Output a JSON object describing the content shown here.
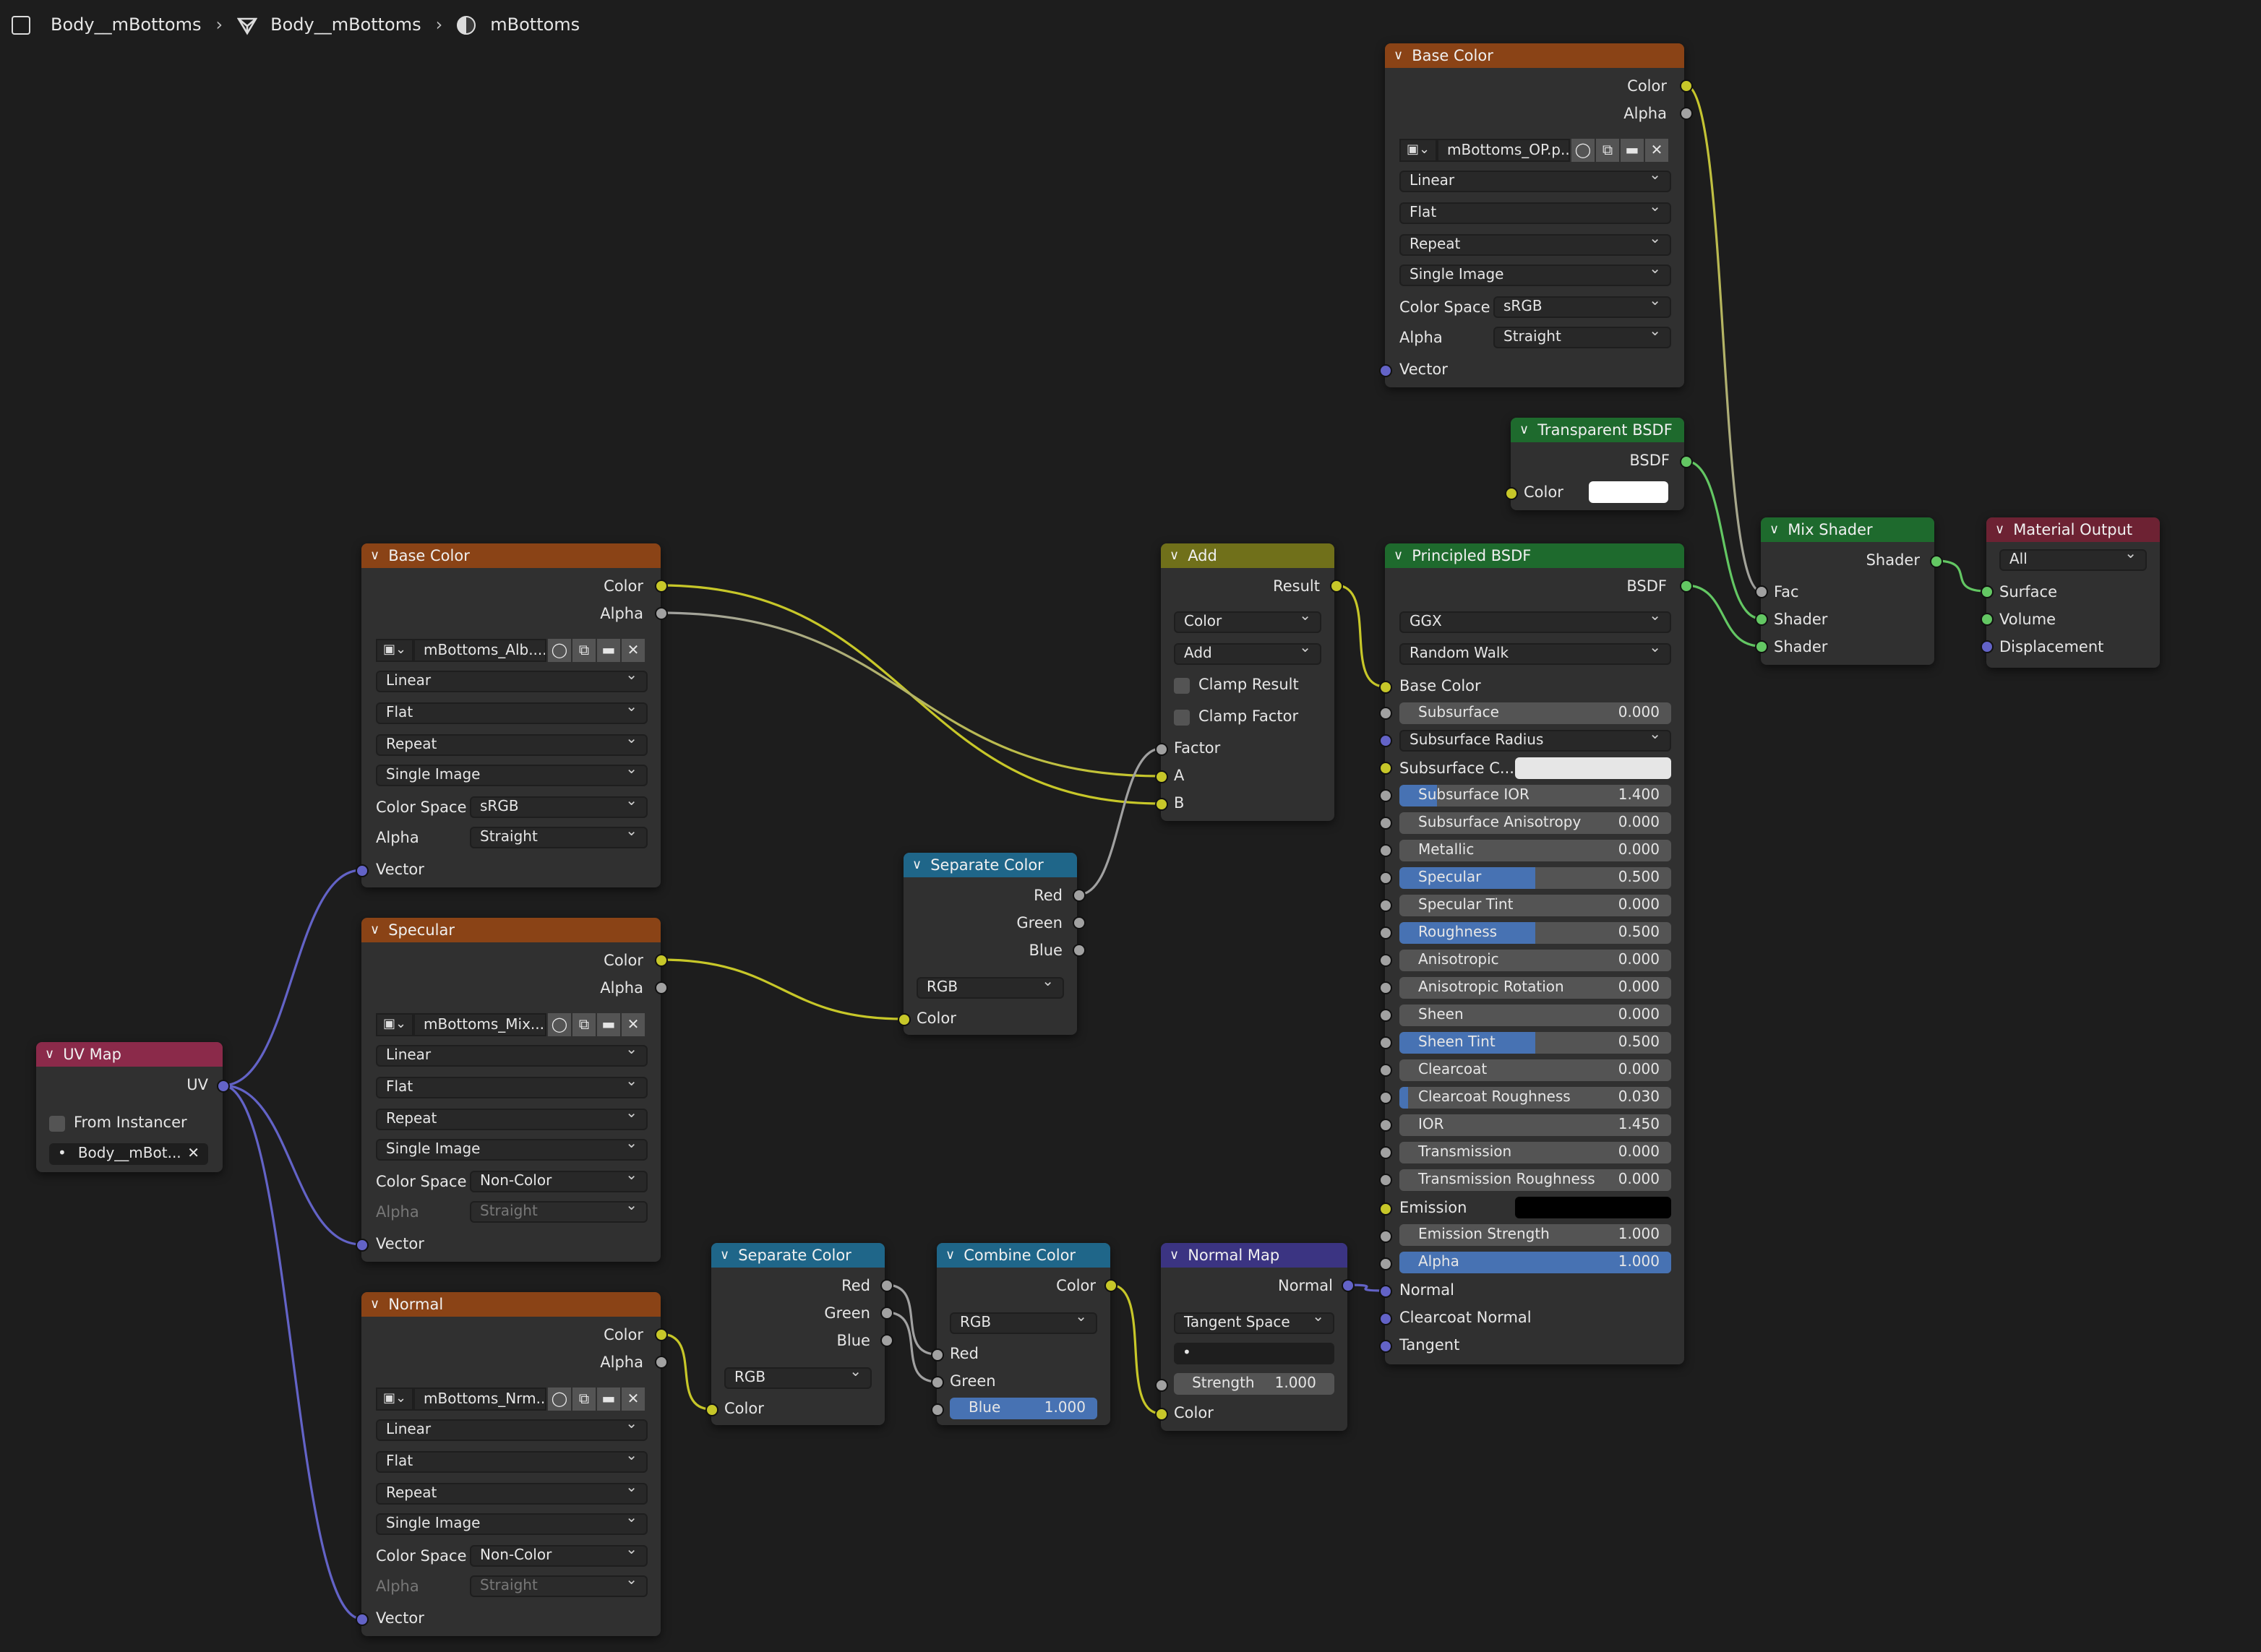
{
  "breadcrumb": {
    "object": "Body__mBottoms",
    "mesh": "Body__mBottoms",
    "material": "mBottoms"
  },
  "colors": {
    "background": "#1d1d1d",
    "texture_header": "#8a4316",
    "converter_header": "#1f6689",
    "shader_header": "#1e6a2d",
    "vector_header": "#3b3482",
    "output_header": "#6d2233",
    "uv_header": "#8b2a4a",
    "color_socket": "#c7c729",
    "shader_socket": "#63c763",
    "vector_socket": "#6363c7",
    "float_socket": "#a1a1a1",
    "slider_fill": "#4772b3"
  },
  "nodes": {
    "tex_top": {
      "title": "Base Color",
      "out_color": "Color",
      "out_alpha": "Alpha",
      "image": "mBottoms_OP.p...",
      "interpolation": "Linear",
      "projection": "Flat",
      "extension": "Repeat",
      "source": "Single Image",
      "color_space_label": "Color Space",
      "color_space": "sRGB",
      "alpha_label": "Alpha",
      "alpha": "Straight",
      "in_vector": "Vector"
    },
    "tex_base": {
      "title": "Base Color",
      "out_color": "Color",
      "out_alpha": "Alpha",
      "image": "mBottoms_Alb....",
      "interpolation": "Linear",
      "projection": "Flat",
      "extension": "Repeat",
      "source": "Single Image",
      "color_space_label": "Color Space",
      "color_space": "sRGB",
      "alpha_label": "Alpha",
      "alpha": "Straight",
      "in_vector": "Vector"
    },
    "tex_spec": {
      "title": "Specular",
      "out_color": "Color",
      "out_alpha": "Alpha",
      "image": "mBottoms_Mix....",
      "interpolation": "Linear",
      "projection": "Flat",
      "extension": "Repeat",
      "source": "Single Image",
      "color_space_label": "Color Space",
      "color_space": "Non-Color",
      "alpha_label": "Alpha",
      "alpha": "Straight",
      "in_vector": "Vector"
    },
    "tex_normal": {
      "title": "Normal",
      "out_color": "Color",
      "out_alpha": "Alpha",
      "image": "mBottoms_Nrm....",
      "interpolation": "Linear",
      "projection": "Flat",
      "extension": "Repeat",
      "source": "Single Image",
      "color_space_label": "Color Space",
      "color_space": "Non-Color",
      "alpha_label": "Alpha",
      "alpha": "Straight",
      "in_vector": "Vector"
    },
    "uvmap": {
      "title": "UV Map",
      "out_uv": "UV",
      "from_instancer": "From Instancer",
      "uv_name": "Body__mBot..."
    },
    "sep1": {
      "title": "Separate Color",
      "out_red": "Red",
      "out_green": "Green",
      "out_blue": "Blue",
      "mode": "RGB",
      "in_color": "Color"
    },
    "sep2": {
      "title": "Separate Color",
      "out_red": "Red",
      "out_green": "Green",
      "out_blue": "Blue",
      "mode": "RGB",
      "in_color": "Color"
    },
    "combine": {
      "title": "Combine Color",
      "out_color": "Color",
      "mode": "RGB",
      "in_red": "Red",
      "in_green": "Green",
      "blue_label": "Blue",
      "blue_value": "1.000",
      "blue_fraction": 1.0
    },
    "normalmap": {
      "title": "Normal Map",
      "out_normal": "Normal",
      "space": "Tangent Space",
      "uv": "•",
      "strength_label": "Strength",
      "strength_value": "1.000",
      "in_color": "Color"
    },
    "add": {
      "title": "Add",
      "out_result": "Result",
      "data_type": "Color",
      "blend": "Add",
      "clamp_result": "Clamp Result",
      "clamp_factor": "Clamp Factor",
      "in_factor": "Factor",
      "in_a": "A",
      "in_b": "B"
    },
    "transparent": {
      "title": "Transparent BSDF",
      "out_bsdf": "BSDF",
      "in_color": "Color"
    },
    "mix": {
      "title": "Mix Shader",
      "out_shader": "Shader",
      "in_fac": "Fac",
      "in_shader1": "Shader",
      "in_shader2": "Shader"
    },
    "output": {
      "title": "Material Output",
      "target": "All",
      "in_surface": "Surface",
      "in_volume": "Volume",
      "in_displacement": "Displacement"
    },
    "principled": {
      "title": "Principled BSDF",
      "out_bsdf": "BSDF",
      "distribution": "GGX",
      "subsurface_method": "Random Walk",
      "base_color": "Base Color",
      "subsurface_radius": "Subsurface Radius",
      "subsurface_color": "Subsurface C...",
      "emission": "Emission",
      "normal": "Normal",
      "clearcoat_normal": "Clearcoat Normal",
      "tangent": "Tangent",
      "fields": [
        {
          "label": "Subsurface",
          "value": "0.000",
          "fraction": 0.0
        },
        {
          "label": "Subsurface IOR",
          "value": "1.400",
          "fraction": 0.14
        },
        {
          "label": "Subsurface Anisotropy",
          "value": "0.000",
          "fraction": 0.0
        },
        {
          "label": "Metallic",
          "value": "0.000",
          "fraction": 0.0
        },
        {
          "label": "Specular",
          "value": "0.500",
          "fraction": 0.5
        },
        {
          "label": "Specular Tint",
          "value": "0.000",
          "fraction": 0.0
        },
        {
          "label": "Roughness",
          "value": "0.500",
          "fraction": 0.5
        },
        {
          "label": "Anisotropic",
          "value": "0.000",
          "fraction": 0.0
        },
        {
          "label": "Anisotropic Rotation",
          "value": "0.000",
          "fraction": 0.0
        },
        {
          "label": "Sheen",
          "value": "0.000",
          "fraction": 0.0
        },
        {
          "label": "Sheen Tint",
          "value": "0.500",
          "fraction": 0.5
        },
        {
          "label": "Clearcoat",
          "value": "0.000",
          "fraction": 0.0
        },
        {
          "label": "Clearcoat Roughness",
          "value": "0.030",
          "fraction": 0.03
        },
        {
          "label": "IOR",
          "value": "1.450",
          "fraction": 0.0
        },
        {
          "label": "Transmission",
          "value": "0.000",
          "fraction": 0.0
        },
        {
          "label": "Transmission Roughness",
          "value": "0.000",
          "fraction": 0.0
        }
      ],
      "emission_strength": {
        "label": "Emission Strength",
        "value": "1.000",
        "fraction": 0.0
      },
      "alpha": {
        "label": "Alpha",
        "value": "1.000",
        "fraction": 1.0
      }
    }
  }
}
